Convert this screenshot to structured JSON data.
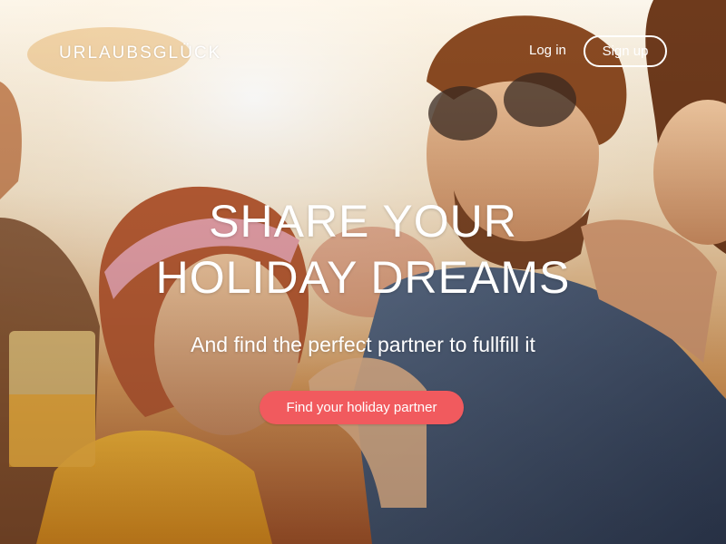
{
  "navbar": {
    "brand": "URLAUBSGLÜCK",
    "login_label": "Log in",
    "signup_label": "Sign up"
  },
  "hero": {
    "headline_line1": "SHARE YOUR",
    "headline_line2": "HOLIDAY DREAMS",
    "subheadline": "And find the perfect partner to fullfill it",
    "cta_label": "Find your holiday partner"
  },
  "colors": {
    "cta_background": "#f15a5e",
    "text": "#ffffff"
  }
}
